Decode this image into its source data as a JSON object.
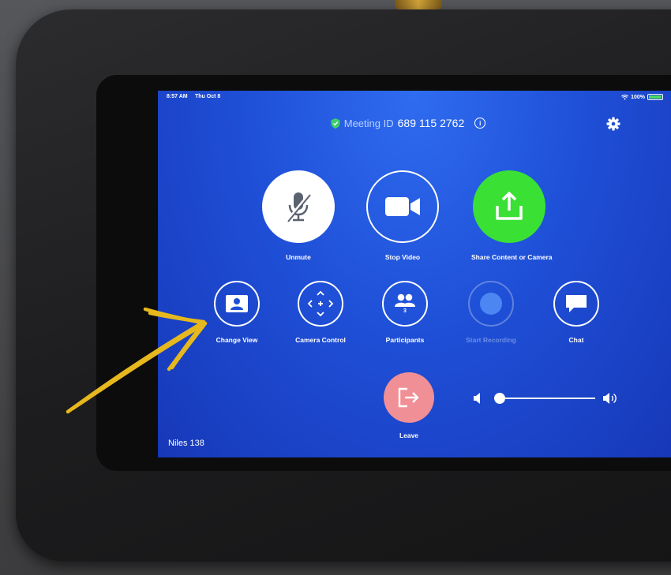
{
  "status": {
    "time": "8:57 AM",
    "date": "Thu Oct 8",
    "battery": "100%"
  },
  "meeting": {
    "label": "Meeting ID",
    "number": "689 115 2762"
  },
  "buttons_main": [
    {
      "label": "Unmute",
      "icon": "muted-mic-icon"
    },
    {
      "label": "Stop Video",
      "icon": "video-camera-icon"
    },
    {
      "label": "Share Content or Camera",
      "icon": "share-upload-icon"
    }
  ],
  "buttons_secondary": [
    {
      "label": "Change View",
      "icon": "change-view-icon"
    },
    {
      "label": "Camera Control",
      "icon": "camera-control-icon"
    },
    {
      "label": "Participants",
      "icon": "participants-icon",
      "count": "3"
    },
    {
      "label": "Start Recording",
      "icon": "record-icon",
      "disabled": true
    },
    {
      "label": "Chat",
      "icon": "chat-icon"
    }
  ],
  "leave": {
    "label": "Leave"
  },
  "volume": {
    "level": 0
  },
  "room_name": "Niles 138",
  "colors": {
    "screen": "#1f50d8",
    "share": "#3ae034",
    "leave": "#f08f95",
    "annotation": "#e6b81e"
  }
}
